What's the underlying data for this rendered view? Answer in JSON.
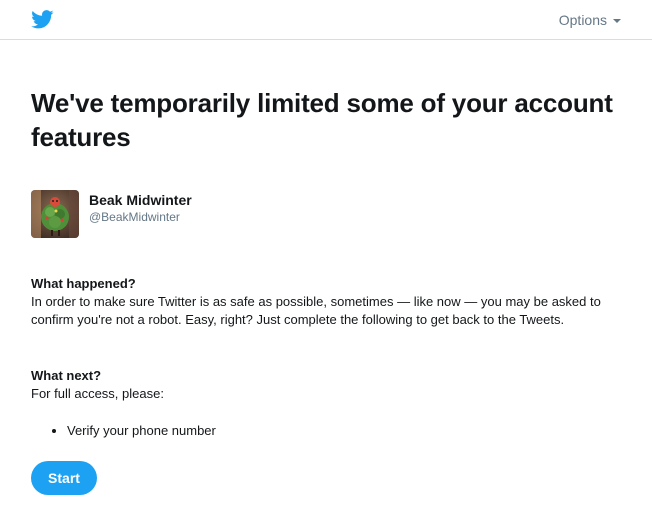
{
  "header": {
    "logo_icon": "twitter-bird-icon",
    "options_label": "Options",
    "options_icon": "caret-down-icon"
  },
  "colors": {
    "brand_blue": "#1da1f2",
    "text_primary": "#14171a",
    "text_secondary": "#657786"
  },
  "main": {
    "title": "We've temporarily limited some of your account features",
    "user": {
      "name": "Beak Midwinter",
      "handle": "@BeakMidwinter"
    },
    "what_happened": {
      "heading": "What happened?",
      "text": "In order to make sure Twitter is as safe as possible, sometimes — like now — you may be asked to confirm you're not a robot. Easy, right? Just complete the following to get back to the Tweets."
    },
    "what_next": {
      "heading": "What next?",
      "text": "For full access, please:",
      "steps": [
        "Verify your phone number"
      ]
    },
    "start_label": "Start"
  }
}
